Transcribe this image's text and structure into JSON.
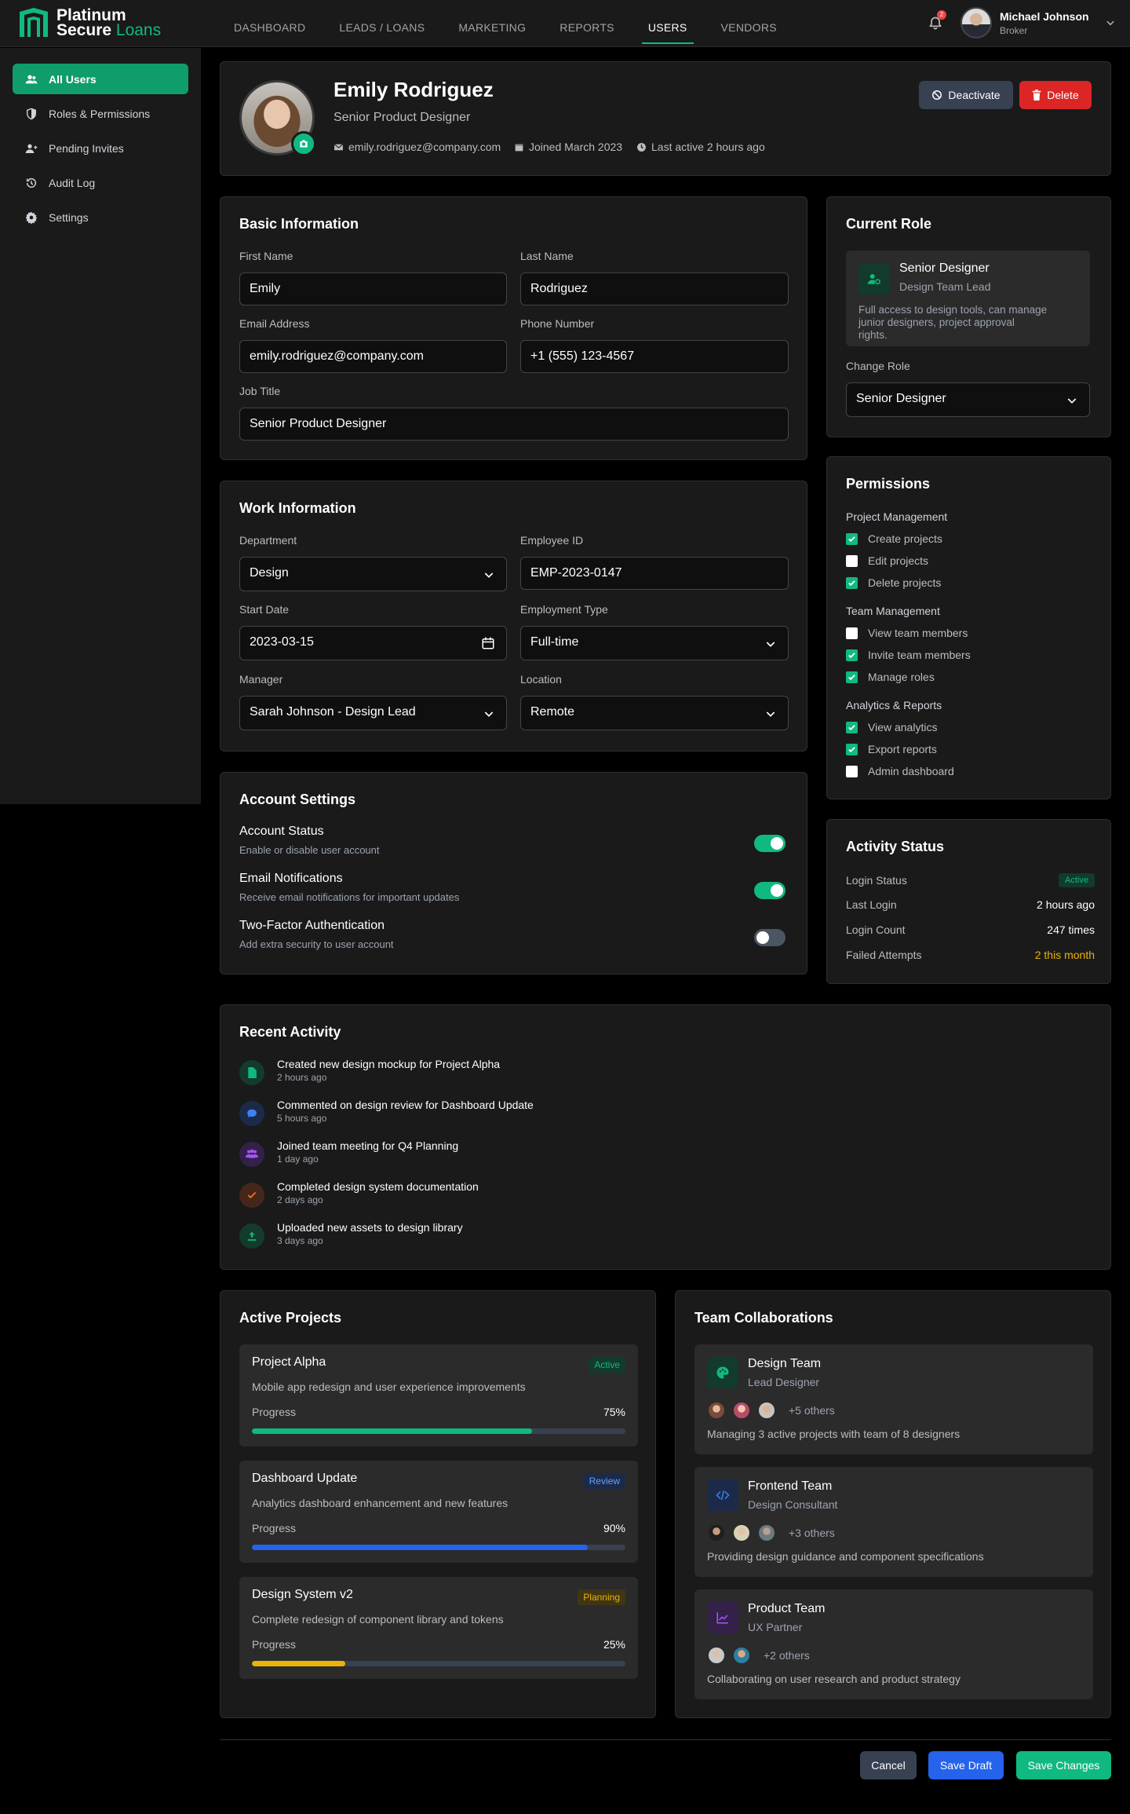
{
  "brand": {
    "line1": "Platinum",
    "line2a": "Secure",
    "line2b": "Loans",
    "accent": "#10b981"
  },
  "nav": [
    "DASHBOARD",
    "LEADS / LOANS",
    "MARKETING",
    "REPORTS",
    "USERS",
    "VENDORS"
  ],
  "nav_active": "USERS",
  "notifications": {
    "count": "2"
  },
  "current_user": {
    "name": "Michael Johnson",
    "role": "Broker"
  },
  "sidebar": [
    {
      "label": "All Users",
      "icon": "users-icon",
      "active": true
    },
    {
      "label": "Roles & Permissions",
      "icon": "shield-icon"
    },
    {
      "label": "Pending Invites",
      "icon": "user-plus-icon"
    },
    {
      "label": "Audit Log",
      "icon": "history-icon"
    },
    {
      "label": "Settings",
      "icon": "gear-icon"
    }
  ],
  "profile": {
    "name": "Emily Rodriguez",
    "title": "Senior Product Designer",
    "email": "emily.rodriguez@company.com",
    "joined": "Joined March 2023",
    "last_active": "Last active 2 hours ago",
    "deactivate_label": "Deactivate",
    "delete_label": "Delete"
  },
  "basic": {
    "title": "Basic Information",
    "first_name_label": "First Name",
    "first_name": "Emily",
    "last_name_label": "Last Name",
    "last_name": "Rodriguez",
    "email_label": "Email Address",
    "email": "emily.rodriguez@company.com",
    "phone_label": "Phone Number",
    "phone": "+1 (555) 123-4567",
    "job_title_label": "Job Title",
    "job_title": "Senior Product Designer"
  },
  "work": {
    "title": "Work Information",
    "department_label": "Department",
    "department": "Design",
    "employee_id_label": "Employee ID",
    "employee_id": "EMP-2023-0147",
    "start_date_label": "Start Date",
    "start_date": "2023-03-15",
    "employment_type_label": "Employment Type",
    "employment_type": "Full-time",
    "manager_label": "Manager",
    "manager": "Sarah Johnson - Design Lead",
    "location_label": "Location",
    "location": "Remote"
  },
  "account": {
    "title": "Account Settings",
    "items": [
      {
        "title": "Account Status",
        "desc": "Enable or disable user account",
        "on": true
      },
      {
        "title": "Email Notifications",
        "desc": "Receive email notifications for important updates",
        "on": true
      },
      {
        "title": "Two-Factor Authentication",
        "desc": "Add extra security to user account",
        "on": false
      }
    ]
  },
  "role": {
    "title": "Current Role",
    "name": "Senior Designer",
    "subtitle": "Design Team Lead",
    "desc_lines": [
      "Full access to design tools, can manage",
      "junior designers, project approval",
      "rights."
    ],
    "change_label": "Change Role",
    "selected": "Senior Designer"
  },
  "permissions": {
    "title": "Permissions",
    "groups": [
      {
        "name": "Project Management",
        "items": [
          {
            "label": "Create projects",
            "checked": true
          },
          {
            "label": "Edit projects",
            "checked": false
          },
          {
            "label": "Delete projects",
            "checked": true
          }
        ]
      },
      {
        "name": "Team Management",
        "items": [
          {
            "label": "View team members",
            "checked": false
          },
          {
            "label": "Invite team members",
            "checked": true
          },
          {
            "label": "Manage roles",
            "checked": true
          }
        ]
      },
      {
        "name": "Analytics & Reports",
        "items": [
          {
            "label": "View analytics",
            "checked": true
          },
          {
            "label": "Export reports",
            "checked": true
          },
          {
            "label": "Admin dashboard",
            "checked": false
          }
        ]
      }
    ]
  },
  "activity_status": {
    "title": "Activity Status",
    "rows": [
      {
        "key": "Login Status",
        "value": "Active"
      },
      {
        "key": "Last Login",
        "value": "2 hours ago"
      },
      {
        "key": "Login Count",
        "value": "247 times"
      },
      {
        "key": "Failed Attempts",
        "value": "2 this month"
      }
    ]
  },
  "recent": {
    "title": "Recent Activity",
    "items": [
      {
        "text": "Created new design mockup for Project Alpha",
        "time": "2 hours ago",
        "icon": "file-icon",
        "color": "#10b981",
        "bg": "#123b2c"
      },
      {
        "text": "Commented on design review for Dashboard Update",
        "time": "5 hours ago",
        "icon": "comment-icon",
        "color": "#3b82f6",
        "bg": "#1c2a4a"
      },
      {
        "text": "Joined team meeting for Q4 Planning",
        "time": "1 day ago",
        "icon": "users-icon",
        "color": "#a855f7",
        "bg": "#33214a"
      },
      {
        "text": "Completed design system documentation",
        "time": "2 days ago",
        "icon": "check-icon",
        "color": "#f97316",
        "bg": "#45261a"
      },
      {
        "text": "Uploaded new assets to design library",
        "time": "3 days ago",
        "icon": "upload-icon",
        "color": "#10b981",
        "bg": "#123b2c"
      }
    ]
  },
  "projects": {
    "title": "Active Projects",
    "progress_label": "Progress",
    "items": [
      {
        "name": "Project Alpha",
        "badge": "Active",
        "desc": "Mobile app redesign and user experience improvements",
        "progress": 75,
        "progress_text": "75%",
        "color": "#10b981",
        "badge_bg": "#123b2c"
      },
      {
        "name": "Dashboard Update",
        "badge": "Review",
        "desc": "Analytics dashboard enhancement and new features",
        "progress": 90,
        "progress_text": "90%",
        "color": "#2563eb",
        "badge_bg": "#1c2a4a"
      },
      {
        "name": "Design System v2",
        "badge": "Planning",
        "desc": "Complete redesign of component library and tokens",
        "progress": 25,
        "progress_text": "25%",
        "color": "#eab308",
        "badge_bg": "#403514"
      }
    ]
  },
  "teams": {
    "title": "Team Collaborations",
    "items": [
      {
        "name": "Design Team",
        "role": "Lead Designer",
        "others": "+5 others",
        "desc": "Managing 3 active projects with team of 8 designers",
        "icon": "palette-icon",
        "color": "#10b981",
        "bg": "#123b2c"
      },
      {
        "name": "Frontend Team",
        "role": "Design Consultant",
        "others": "+3 others",
        "desc": "Providing design guidance and component specifications",
        "icon": "code-icon",
        "color": "#3b82f6",
        "bg": "#1c2a4a"
      },
      {
        "name": "Product Team",
        "role": "UX Partner",
        "others": "+2 others",
        "desc": "Collaborating on user research and product strategy",
        "icon": "chart-icon",
        "color": "#a855f7",
        "bg": "#33214a"
      }
    ]
  },
  "footer": {
    "cancel": "Cancel",
    "save_draft": "Save Draft",
    "save_changes": "Save Changes"
  }
}
